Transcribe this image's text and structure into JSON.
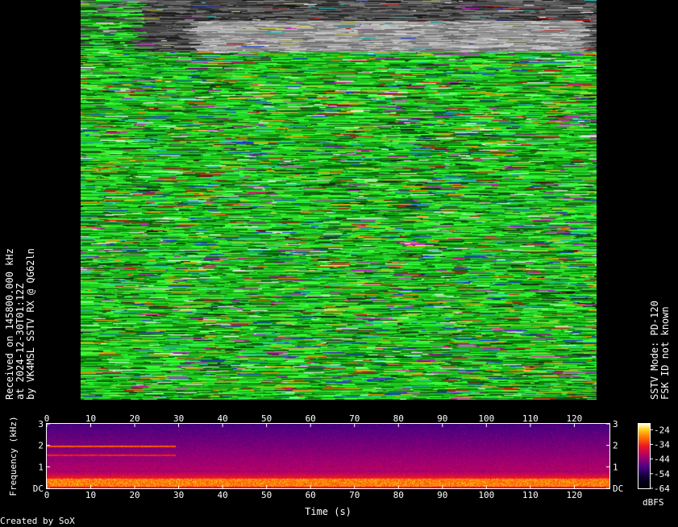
{
  "caption_left": {
    "line1": "Received on 145800.000 kHz",
    "line2": "at 2024-12-30T01:12Z",
    "line3": "by VK4MSL SSTV RX @ QG62ln"
  },
  "caption_right": {
    "line1": "SSTV Mode: PD-120",
    "line2": "FSK ID not known"
  },
  "spectrogram": {
    "xlabel": "Time (s)",
    "ylabel": "Frequency (kHz)",
    "x_ticks": [
      "0",
      "10",
      "20",
      "30",
      "40",
      "50",
      "60",
      "70",
      "80",
      "90",
      "100",
      "110",
      "120"
    ],
    "x_tick_values": [
      0,
      10,
      20,
      30,
      40,
      50,
      60,
      70,
      80,
      90,
      100,
      110,
      120
    ],
    "x_max": 128,
    "y_ticks": [
      "DC",
      "1",
      "2",
      "3"
    ],
    "y_tick_values": [
      0,
      1,
      2,
      3
    ],
    "y_max": 3
  },
  "colorbar": {
    "unit": "dBFS",
    "ticks": [
      "-24",
      "-34",
      "-44",
      "-54",
      "-64"
    ],
    "tick_values": [
      -24,
      -34,
      -44,
      -54,
      -64
    ],
    "min": -64,
    "max": -20
  },
  "credit": "Created by SoX"
}
